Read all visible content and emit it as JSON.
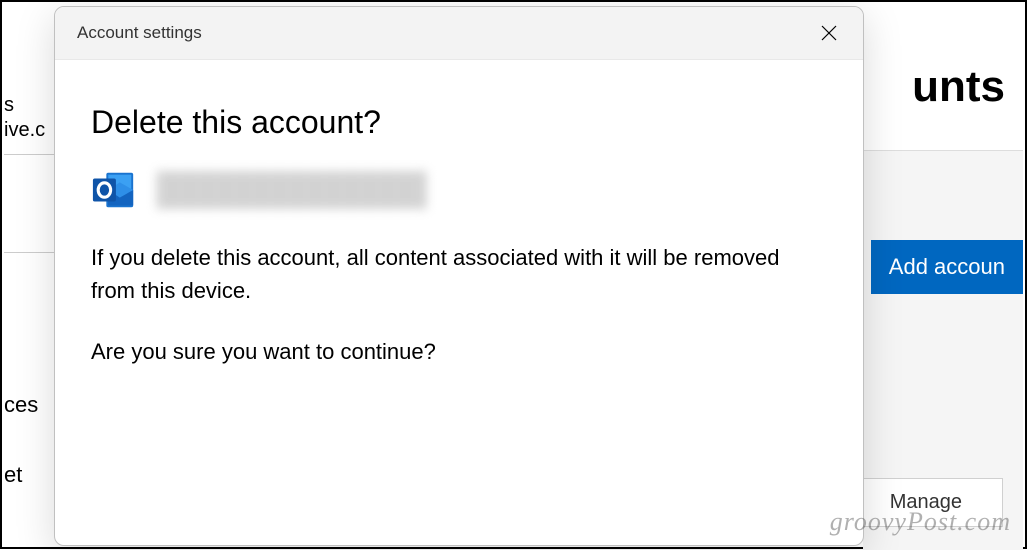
{
  "background": {
    "page_title_fragment": "unts",
    "sidebar_fragment_1": "s",
    "sidebar_fragment_2": "ive.c",
    "sidebar_fragment_3": "ces",
    "sidebar_fragment_4": "et",
    "add_account_button": "Add accoun",
    "manage_button": "Manage"
  },
  "modal": {
    "header_title": "Account settings",
    "heading": "Delete this account?",
    "warning_text": "If you delete this account, all content associated with it will be removed from this device.",
    "confirm_text": "Are you sure you want to continue?"
  },
  "watermark": "groovyPost.com"
}
